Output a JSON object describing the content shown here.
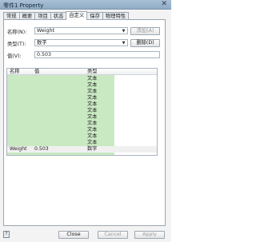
{
  "window": {
    "title": "零件1 Property",
    "close_glyph": "✕"
  },
  "tabs": [
    "常规",
    "概要",
    "项目",
    "状态",
    "自定义",
    "保存",
    "物理特性"
  ],
  "active_tab": "自定义",
  "form": {
    "name_label": "名称(N):",
    "name_value": "Weight",
    "type_label": "类型(T):",
    "type_value": "数字",
    "value_label": "值(V):",
    "value_value": "0.503",
    "add_button": "添加(A)",
    "delete_button": "删除(D)"
  },
  "grid": {
    "columns": [
      "名称",
      "值",
      "类型"
    ],
    "rows": [
      {
        "name": "",
        "value": "",
        "type": "文本"
      },
      {
        "name": "",
        "value": "",
        "type": "文本"
      },
      {
        "name": "",
        "value": "",
        "type": "文本"
      },
      {
        "name": "",
        "value": "",
        "type": "文本"
      },
      {
        "name": "",
        "value": "",
        "type": "文本"
      },
      {
        "name": "",
        "value": "",
        "type": "文本"
      },
      {
        "name": "",
        "value": "",
        "type": "文本"
      },
      {
        "name": "",
        "value": "",
        "type": "文本"
      },
      {
        "name": "",
        "value": "",
        "type": "文本"
      },
      {
        "name": "",
        "value": "",
        "type": "文本"
      },
      {
        "name": "",
        "value": "",
        "type": "文本"
      },
      {
        "name": "Weight",
        "value": "0.503",
        "type": "数字"
      }
    ]
  },
  "footer": {
    "status_icon": "help-icon",
    "close_button": "Close",
    "cancel_button": "Cancel",
    "apply_button": "Apply"
  }
}
